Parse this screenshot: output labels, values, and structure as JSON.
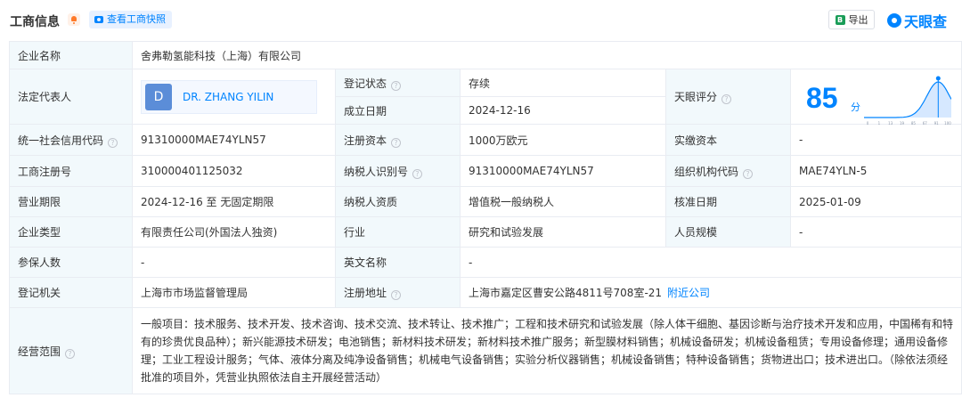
{
  "header": {
    "title": "工商信息",
    "snapshot_label": "查看工商快照",
    "export_label": "导出",
    "export_icon_text": "B",
    "brand": "天眼查"
  },
  "fields": {
    "company_name_label": "企业名称",
    "company_name": "舍弗勒氢能科技（上海）有限公司",
    "legal_rep_label": "法定代表人",
    "legal_rep_initial": "D",
    "legal_rep_name": "DR. ZHANG YILIN",
    "reg_status_label": "登记状态",
    "reg_status": "存续",
    "founded_label": "成立日期",
    "founded": "2024-12-16",
    "score_label": "天眼评分",
    "score": "85",
    "score_unit": "分",
    "credit_code_label": "统一社会信用代码",
    "credit_code": "91310000MAE74YLN57",
    "reg_capital_label": "注册资本",
    "reg_capital": "1000万欧元",
    "paid_capital_label": "实缴资本",
    "paid_capital": "-",
    "reg_number_label": "工商注册号",
    "reg_number": "310000401125032",
    "taxpayer_id_label": "纳税人识别号",
    "taxpayer_id": "91310000MAE74YLN57",
    "org_code_label": "组织机构代码",
    "org_code": "MAE74YLN-5",
    "term_label": "营业期限",
    "term": "2024-12-16 至 无固定期限",
    "taxpayer_qual_label": "纳税人资质",
    "taxpayer_qual": "增值税一般纳税人",
    "approval_date_label": "核准日期",
    "approval_date": "2025-01-09",
    "company_type_label": "企业类型",
    "company_type": "有限责任公司(外国法人独资)",
    "industry_label": "行业",
    "industry": "研究和试验发展",
    "staff_size_label": "人员规模",
    "staff_size": "-",
    "insured_label": "参保人数",
    "insured": "-",
    "english_name_label": "英文名称",
    "english_name": "-",
    "authority_label": "登记机关",
    "authority": "上海市市场监督管理局",
    "address_label": "注册地址",
    "address": "上海市嘉定区曹安公路4811号708室-21",
    "nearby_label": "附近公司",
    "scope_label": "经营范围",
    "scope": "一般项目：技术服务、技术开发、技术咨询、技术交流、技术转让、技术推广；工程和技术研究和试验发展（除人体干细胞、基因诊断与治疗技术开发和应用，中国稀有和特有的珍贵优良品种）；新兴能源技术研发；电池销售；新材料技术研发；新材料技术推广服务；新型膜材料销售；机械设备研发；机械设备租赁；专用设备修理；通用设备修理；工业工程设计服务；气体、液体分离及纯净设备销售；机械电气设备销售；实验分析仪器销售；机械设备销售；特种设备销售；货物进出口；技术进出口。（除依法须经批准的项目外，凭营业执照依法自主开展经营活动）"
  },
  "score_chart": {
    "value": 85,
    "ticks": [
      "0",
      "1",
      "13",
      "19",
      "85",
      "67",
      "91",
      "100"
    ]
  },
  "help_icon_glyph": "?",
  "colors": {
    "accent": "#0084ff",
    "status_green": "#1aad19",
    "label_bg": "#f2f9fc",
    "border": "#e9ecf2"
  },
  "icons": [
    "bell-icon",
    "camera-icon",
    "excel-icon",
    "help-icon",
    "tianyancha-logo-icon"
  ]
}
